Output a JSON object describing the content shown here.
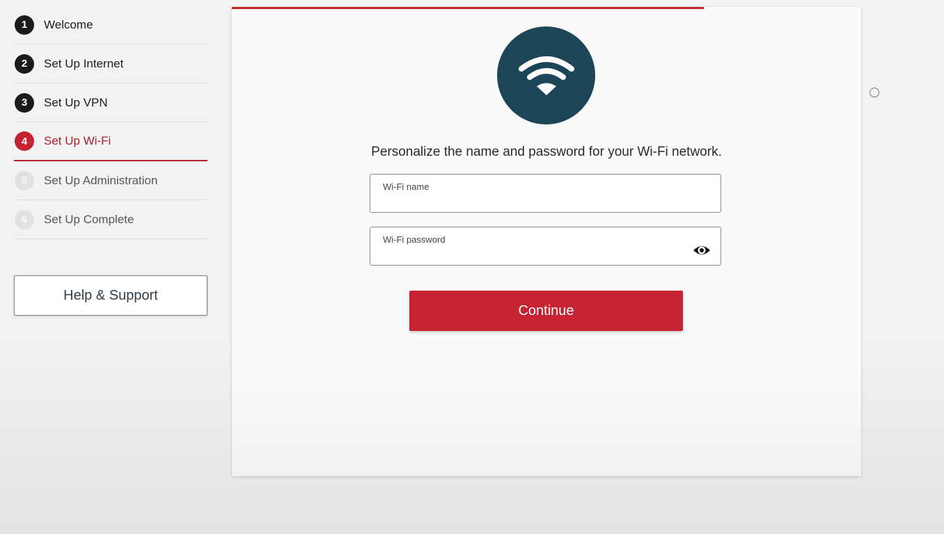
{
  "steps": [
    {
      "num": "1",
      "label": "Welcome",
      "state": "done"
    },
    {
      "num": "2",
      "label": "Set Up Internet",
      "state": "done"
    },
    {
      "num": "3",
      "label": "Set Up VPN",
      "state": "done"
    },
    {
      "num": "4",
      "label": "Set Up Wi-Fi",
      "state": "active"
    },
    {
      "num": "5",
      "label": "Set Up Administration",
      "state": "disabled"
    },
    {
      "num": "6",
      "label": "Set Up Complete",
      "state": "disabled"
    }
  ],
  "help_label": "Help & Support",
  "progress_fraction": 0.75,
  "icon": "wifi-icon",
  "subtitle": "Personalize the name and password for your Wi-Fi network.",
  "wifi_name": {
    "label": "Wi-Fi name",
    "value": ""
  },
  "wifi_password": {
    "label": "Wi-Fi password",
    "value": "",
    "toggle_icon": "eye-icon"
  },
  "continue_label": "Continue",
  "colors": {
    "accent": "#c4232f",
    "icon_bg": "#1c4658",
    "text": "#1b1b1b"
  }
}
